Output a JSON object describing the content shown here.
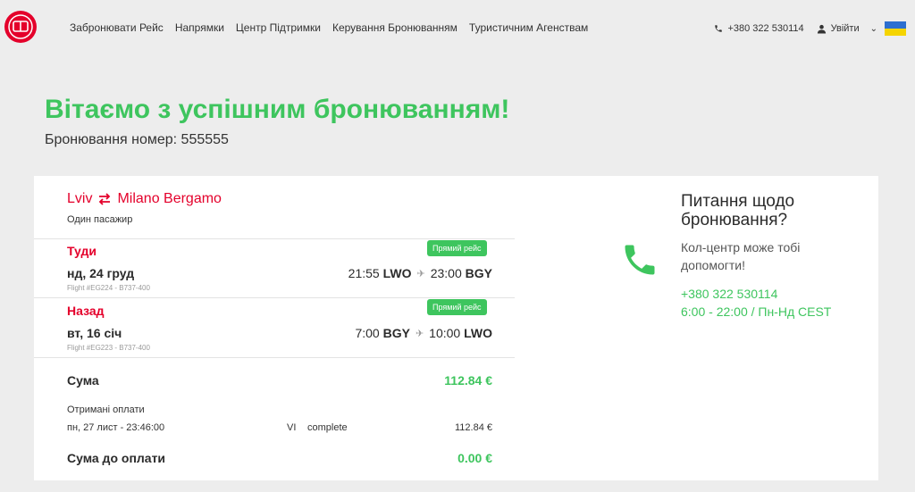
{
  "nav": {
    "items": [
      "Забронювати Рейс",
      "Напрямки",
      "Центр Підтримки",
      "Керування Бронюванням",
      "Туристичним Агенствам"
    ],
    "phone": "+380 322 530114",
    "login": "Увійти"
  },
  "page": {
    "heading": "Вітаємо з успішним бронюванням!",
    "booking_number": "Бронювання номер: 555555"
  },
  "trip": {
    "origin": "Lviv",
    "destination": "Milano Bergamo",
    "passengers": "Один пасажир",
    "outbound": {
      "title": "Туди",
      "badge": "Прямий рейс",
      "date": "нд, 24 груд",
      "dep_time": "21:55",
      "dep_code": "LWO",
      "arr_time": "23:00",
      "arr_code": "BGY",
      "flight": "Flight #EG224 - B737-400"
    },
    "inbound": {
      "title": "Назад",
      "badge": "Прямий рейс",
      "date": "вт, 16 січ",
      "dep_time": "7:00",
      "dep_code": "BGY",
      "arr_time": "10:00",
      "arr_code": "LWO",
      "flight": "Flight #EG223 - B737-400"
    }
  },
  "payment": {
    "sum_label": "Сума",
    "sum_value": "112.84 €",
    "received_label": "Отримані оплати",
    "received_date": "пн, 27 лист - 23:46:00",
    "card_type": "VI",
    "status": "complete",
    "received_amount": "112.84 €",
    "due_label": "Сума до оплати",
    "due_value": "0.00 €"
  },
  "support": {
    "title": "Питання щодо бронювання?",
    "text": "Кол-центр може тобі допомогти!",
    "phone": "+380 322 530114",
    "hours": "6:00 - 22:00 / Пн-Нд CEST"
  },
  "colors": {
    "brand_red": "#e4002b",
    "accent_green": "#3ec55e",
    "background": "#ededed"
  }
}
